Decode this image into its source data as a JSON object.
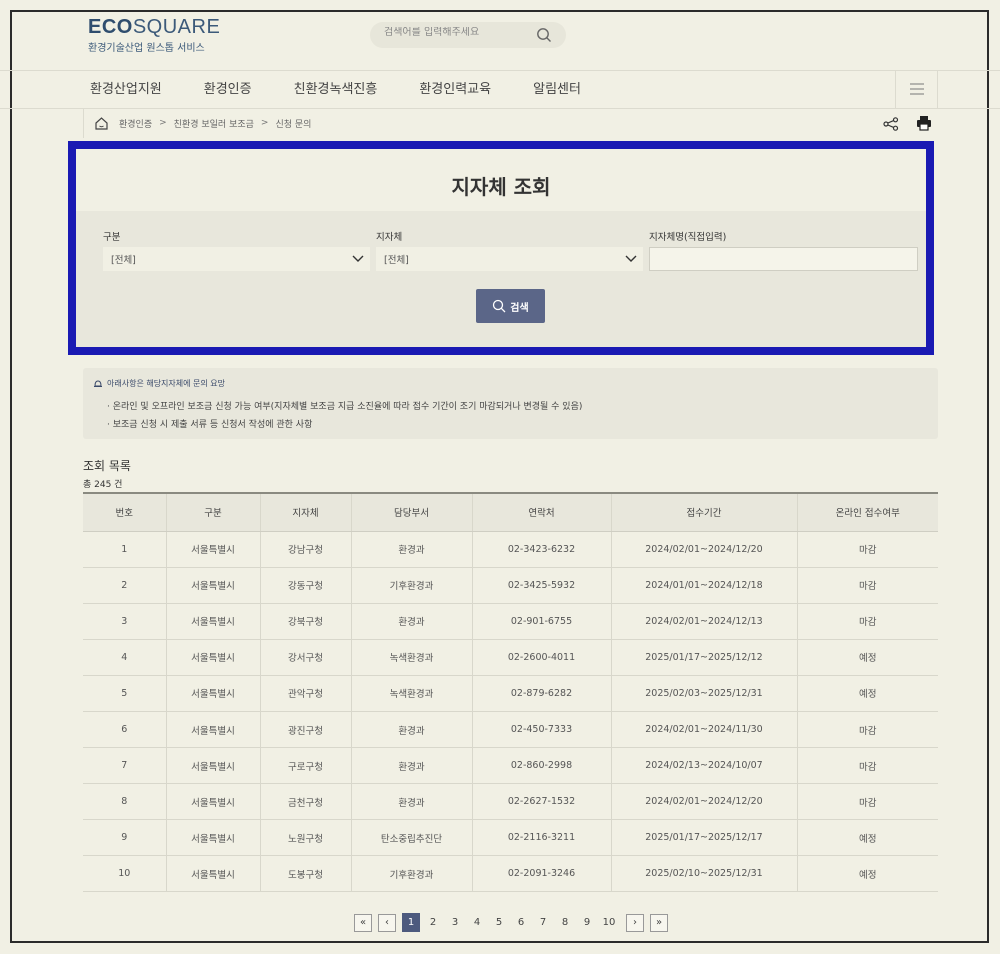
{
  "header": {
    "logo_bold": "ECO",
    "logo_light": "SQUARE",
    "logo_sub": "환경기술산업 원스톱 서비스",
    "search_placeholder": "검색어를 입력해주세요"
  },
  "nav": [
    "환경산업지원",
    "환경인증",
    "친환경녹색진흥",
    "환경인력교육",
    "알림센터"
  ],
  "breadcrumb": [
    "환경인증",
    "친환경 보일러 보조금",
    "신청 문의"
  ],
  "query": {
    "title": "지자체 조회",
    "field1_label": "구분",
    "field1_value": "[전체]",
    "field2_label": "지자체",
    "field2_value": "[전체]",
    "field3_label": "지자체명(직접입력)",
    "field3_value": "",
    "search_button": "검색"
  },
  "notice": {
    "title": "아래사항은 해당지자체에 문의 요망",
    "lines": [
      "· 온라인 및 오프라인 보조금 신청 가능 여부(지자체별 보조금 지급 소진율에 따라 접수 기간이 조기 마감되거나 변경될 수 있음)",
      "· 보조금 신청 시 제출 서류 등 신청서 작성에 관한 사항"
    ]
  },
  "list": {
    "title": "조회 목록",
    "count": "총 245 건",
    "columns": [
      "번호",
      "구분",
      "지자체",
      "담당부서",
      "연락처",
      "접수기간",
      "온라인 접수여부"
    ],
    "rows": [
      [
        "1",
        "서울특별시",
        "강남구청",
        "환경과",
        "02-3423-6232",
        "2024/02/01~2024/12/20",
        "마감"
      ],
      [
        "2",
        "서울특별시",
        "강동구청",
        "기후환경과",
        "02-3425-5932",
        "2024/01/01~2024/12/18",
        "마감"
      ],
      [
        "3",
        "서울특별시",
        "강북구청",
        "환경과",
        "02-901-6755",
        "2024/02/01~2024/12/13",
        "마감"
      ],
      [
        "4",
        "서울특별시",
        "강서구청",
        "녹색환경과",
        "02-2600-4011",
        "2025/01/17~2025/12/12",
        "예정"
      ],
      [
        "5",
        "서울특별시",
        "관악구청",
        "녹색환경과",
        "02-879-6282",
        "2025/02/03~2025/12/31",
        "예정"
      ],
      [
        "6",
        "서울특별시",
        "광진구청",
        "환경과",
        "02-450-7333",
        "2024/02/01~2024/11/30",
        "마감"
      ],
      [
        "7",
        "서울특별시",
        "구로구청",
        "환경과",
        "02-860-2998",
        "2024/02/13~2024/10/07",
        "마감"
      ],
      [
        "8",
        "서울특별시",
        "금천구청",
        "환경과",
        "02-2627-1532",
        "2024/02/01~2024/12/20",
        "마감"
      ],
      [
        "9",
        "서울특별시",
        "노원구청",
        "탄소중립추진단",
        "02-2116-3211",
        "2025/01/17~2025/12/17",
        "예정"
      ],
      [
        "10",
        "서울특별시",
        "도봉구청",
        "기후환경과",
        "02-2091-3246",
        "2025/02/10~2025/12/31",
        "예정"
      ]
    ]
  },
  "pagination": {
    "first": "«",
    "prev": "‹",
    "pages": [
      "1",
      "2",
      "3",
      "4",
      "5",
      "6",
      "7",
      "8",
      "9",
      "10"
    ],
    "active": "1",
    "next": "›",
    "last": "»"
  }
}
